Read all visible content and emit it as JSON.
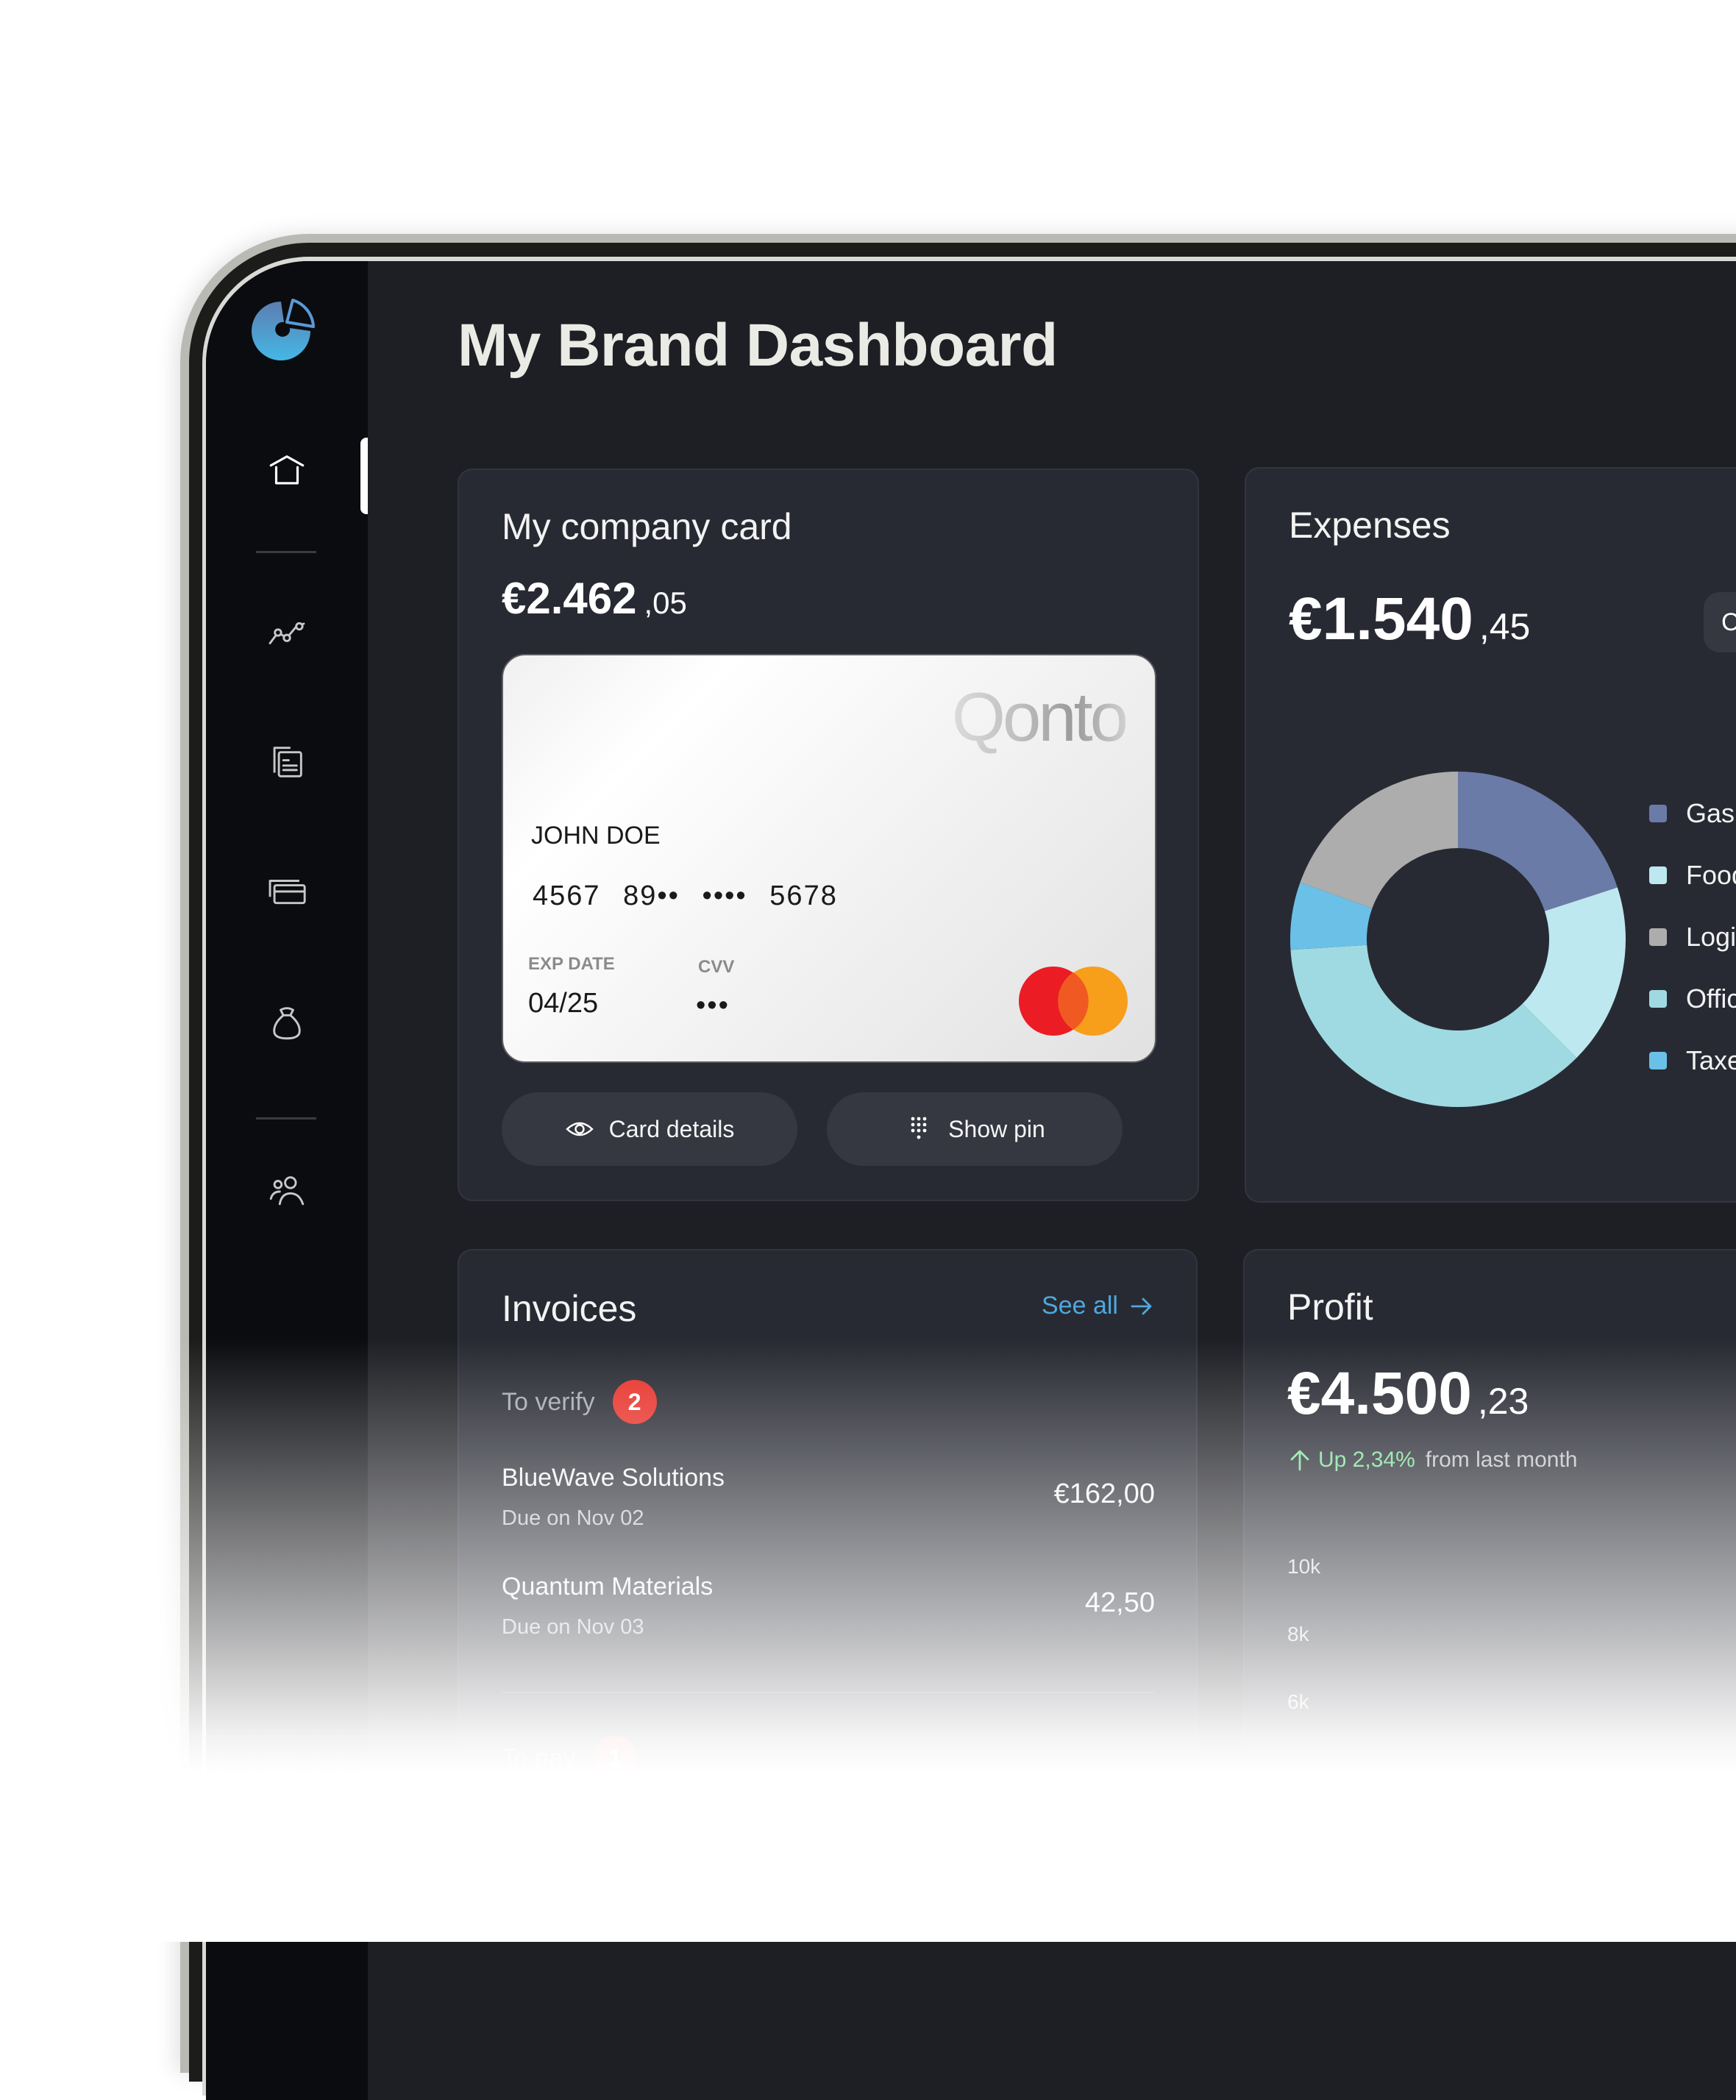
{
  "app": {
    "title": "My Brand Dashboard",
    "logo": "brand-pie-logo"
  },
  "sidebar": {
    "items": [
      {
        "id": "home",
        "icon": "home-icon",
        "active": true
      },
      {
        "id": "analytics",
        "icon": "line-chart-icon",
        "active": false
      },
      {
        "id": "invoices",
        "icon": "documents-icon",
        "active": false
      },
      {
        "id": "cards",
        "icon": "cards-icon",
        "active": false
      },
      {
        "id": "savings",
        "icon": "money-bag-icon",
        "active": false
      },
      {
        "id": "team",
        "icon": "users-icon",
        "active": false
      }
    ]
  },
  "company_card": {
    "title": "My company card",
    "balance_main": "€2.462",
    "balance_cents": ",05",
    "card": {
      "brand": "Qonto",
      "holder": "JOHN DOE",
      "number": "4567 89•• •••• 5678",
      "exp_label": "EXP DATE",
      "exp_value": "04/25",
      "cvv_label": "CVV",
      "cvv_value": "•••",
      "network": "mastercard"
    },
    "buttons": {
      "details": "Card details",
      "pin": "Show pin"
    }
  },
  "expenses": {
    "title": "Expenses",
    "total_main": "€1.540",
    "total_cents": ",45",
    "period_pill": "C",
    "legend": [
      {
        "label": "Gas",
        "color": "#6b7ba8"
      },
      {
        "label": "Food",
        "color": "#bde8ef"
      },
      {
        "label": "Logis",
        "color": "#adadad"
      },
      {
        "label": "Offic",
        "color": "#9fdae3"
      },
      {
        "label": "Taxe",
        "color": "#6bc0e8"
      }
    ]
  },
  "chart_data": {
    "type": "pie",
    "title": "Expenses",
    "categories": [
      "Gas",
      "Food",
      "Office",
      "Taxes",
      "Logistics"
    ],
    "values": [
      20,
      17.5,
      36.5,
      6.5,
      19.5
    ],
    "unit": "percent (estimated)",
    "colors": [
      "#6b7ba8",
      "#bde8ef",
      "#9fdae3",
      "#6bc0e8",
      "#adadad"
    ],
    "donut": true,
    "legend_position": "right"
  },
  "invoices": {
    "title": "Invoices",
    "see_all": "See all",
    "sections": [
      {
        "label": "To verify",
        "count": "2",
        "items": [
          {
            "name": "BlueWave Solutions",
            "due": "Due on Nov 02",
            "amount": "€162,00"
          },
          {
            "name": "Quantum Materials",
            "due": "Due on Nov 03",
            "amount": "42,50"
          }
        ]
      },
      {
        "label": "To pay",
        "count": "1",
        "items": []
      }
    ]
  },
  "profit": {
    "title": "Profit",
    "total_main": "€4.500",
    "total_cents": ",23",
    "trend_value": "Up 2,34%",
    "trend_rest": "from last month",
    "trend_color": "#7ee29a",
    "y_ticks": [
      "10k",
      "8k",
      "6k"
    ]
  }
}
